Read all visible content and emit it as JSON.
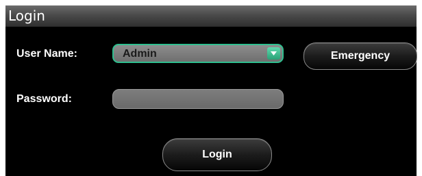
{
  "dialog": {
    "title": "Login"
  },
  "form": {
    "username_label": "User Name:",
    "username_value": "Admin",
    "password_label": "Password:",
    "password_value": ""
  },
  "buttons": {
    "emergency_label": "Emergency",
    "login_label": "Login"
  },
  "colors": {
    "background": "#000000",
    "accent": "#2fbf8f",
    "field": "#757575",
    "text": "#ffffff"
  },
  "icons": {
    "combo_arrow": "chevron-down-icon"
  }
}
